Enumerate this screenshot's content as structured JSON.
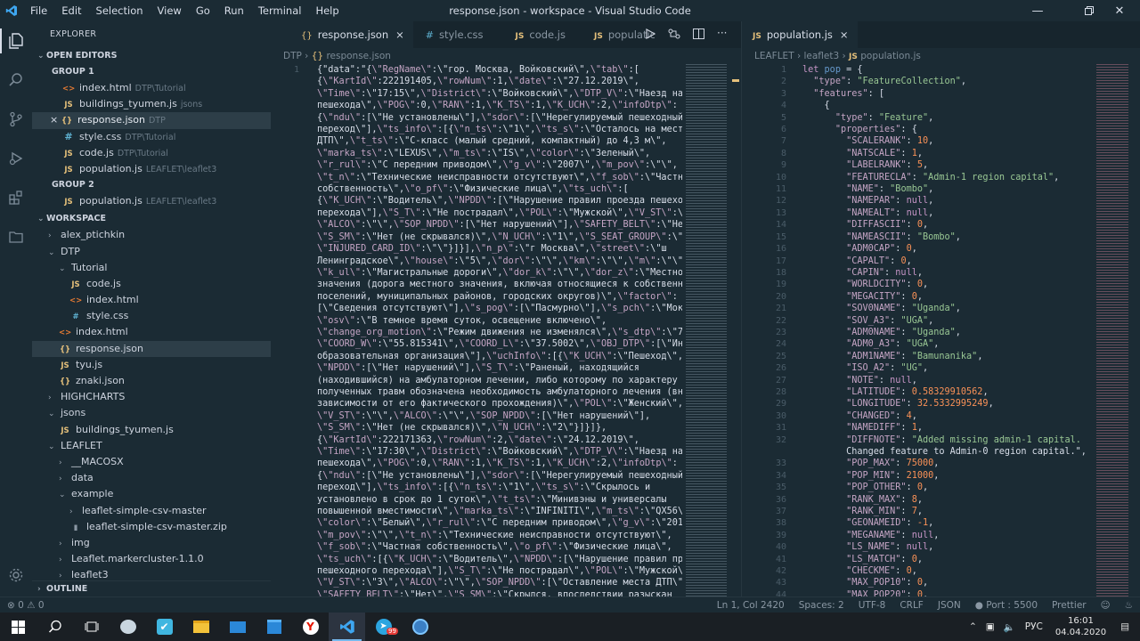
{
  "window": {
    "title": "response.json - workspace - Visual Studio Code",
    "menu": [
      "File",
      "Edit",
      "Selection",
      "View",
      "Go",
      "Run",
      "Terminal",
      "Help"
    ]
  },
  "sidebar": {
    "title": "EXPLORER",
    "open_editors": "OPEN EDITORS",
    "group1": "GROUP 1",
    "group1_items": [
      {
        "name": "index.html",
        "path": "DTP\\Tutorial",
        "icon": "html"
      },
      {
        "name": "buildings_tyumen.js",
        "path": "jsons",
        "icon": "js"
      },
      {
        "name": "response.json",
        "path": "DTP",
        "icon": "json",
        "close": "×"
      },
      {
        "name": "style.css",
        "path": "DTP\\Tutorial",
        "icon": "css"
      },
      {
        "name": "code.js",
        "path": "DTP\\Tutorial",
        "icon": "js"
      },
      {
        "name": "population.js",
        "path": "LEAFLET\\leaflet3",
        "icon": "js"
      }
    ],
    "group2": "GROUP 2",
    "group2_items": [
      {
        "name": "population.js",
        "path": "LEAFLET\\leaflet3",
        "icon": "js"
      }
    ],
    "workspace": "WORKSPACE",
    "tree": [
      {
        "name": "alex_ptichkin",
        "depth": 0,
        "type": "folder"
      },
      {
        "name": "DTP",
        "depth": 0,
        "type": "folder-open"
      },
      {
        "name": "Tutorial",
        "depth": 1,
        "type": "folder-open"
      },
      {
        "name": "code.js",
        "depth": 2,
        "type": "js"
      },
      {
        "name": "index.html",
        "depth": 2,
        "type": "html"
      },
      {
        "name": "style.css",
        "depth": 2,
        "type": "css"
      },
      {
        "name": "index.html",
        "depth": 1,
        "type": "html"
      },
      {
        "name": "response.json",
        "depth": 1,
        "type": "json"
      },
      {
        "name": "tyu.js",
        "depth": 1,
        "type": "js"
      },
      {
        "name": "znaki.json",
        "depth": 1,
        "type": "json"
      },
      {
        "name": "HIGHCHARTS",
        "depth": 0,
        "type": "folder"
      },
      {
        "name": "jsons",
        "depth": 0,
        "type": "folder-open"
      },
      {
        "name": "buildings_tyumen.js",
        "depth": 1,
        "type": "js"
      },
      {
        "name": "LEAFLET",
        "depth": 0,
        "type": "folder-open"
      },
      {
        "name": "__MACOSX",
        "depth": 1,
        "type": "folder"
      },
      {
        "name": "data",
        "depth": 1,
        "type": "folder"
      },
      {
        "name": "example",
        "depth": 1,
        "type": "folder-open"
      },
      {
        "name": "leaflet-simple-csv-master",
        "depth": 2,
        "type": "folder"
      },
      {
        "name": "leaflet-simple-csv-master.zip",
        "depth": 2,
        "type": "zip"
      },
      {
        "name": "img",
        "depth": 1,
        "type": "folder"
      },
      {
        "name": "Leaflet.markercluster-1.1.0",
        "depth": 1,
        "type": "folder"
      },
      {
        "name": "leaflet3",
        "depth": 1,
        "type": "folder"
      }
    ],
    "outline": "OUTLINE"
  },
  "editor1": {
    "tabs": [
      "response.json",
      "style.css",
      "code.js",
      "populatic"
    ],
    "breadcrumb": [
      "DTP",
      "response.json"
    ],
    "lines": [
      "{\"data\":\"{\\\"RegName\\\":\\\"гор. Москва, Войковский\\\",\\\"tab\\\":[",
      "{\\\"KartId\\\":222191405,\\\"rowNum\\\":1,\\\"date\\\":\\\"27.12.2019\\\",",
      "\\\"Time\\\":\\\"17:15\\\",\\\"District\\\":\\\"Войковский\\\",\\\"DTP_V\\\":\\\"Наезд на",
      "пешехода\\\",\\\"POG\\\":0,\\\"RAN\\\":1,\\\"K_TS\\\":1,\\\"K_UCH\\\":2,\\\"infoDtp\\\":",
      "{\\\"ndu\\\":[\\\"Не установлены\\\"],\\\"sdor\\\":[\\\"Нерегулируемый пешеходный",
      "переход\\\"],\\\"ts_info\\\":[{\\\"n_ts\\\":\\\"1\\\",\\\"ts_s\\\":\\\"Осталось на месте",
      "ДТП\\\",\\\"t_ts\\\":\\\"С-класс (малый средний, компактный) до 4,3 м\\\",",
      "\\\"marka_ts\\\":\\\"LEXUS\\\",\\\"m_ts\\\":\\\"IS\\\",\\\"color\\\":\\\"Зеленый\\\",",
      "\\\"r_rul\\\":\\\"С передним приводом\\\",\\\"g_v\\\":\\\"2007\\\",\\\"m_pov\\\":\\\"\\\",",
      "\\\"t_n\\\":\\\"Технические неисправности отсутствуют\\\",\\\"f_sob\\\":\\\"Частная",
      "собственность\\\",\\\"o_pf\\\":\\\"Физические лица\\\",\\\"ts_uch\\\":[",
      "{\\\"K_UCH\\\":\\\"Водитель\\\",\\\"NPDD\\\":[\\\"Нарушение правил проезда пешеходного",
      "перехода\\\"],\\\"S_T\\\":\\\"Не пострадал\\\",\\\"POL\\\":\\\"Мужской\\\",\\\"V_ST\\\":\\\"28\\\",",
      "\\\"ALCO\\\":\\\"\\\",\\\"SOP_NPDD\\\":[\\\"Нет нарушений\\\"],\\\"SAFETY_BELT\\\":\\\"Нет\\\",",
      "\\\"S_SM\\\":\\\"Нет (не скрывался)\\\",\\\"N_UCH\\\":\\\"1\\\",\\\"S_SEAT_GROUP\\\":\\\"\\\",",
      "\\\"INJURED_CARD_ID\\\":\\\"\\\"}]}],\\\"n_p\\\":\\\"г Москва\\\",\\\"street\\\":\\\"ш",
      "Ленинградское\\\",\\\"house\\\":\\\"5\\\",\\\"dor\\\":\\\"\\\",\\\"km\\\":\\\"\\\",\\\"m\\\":\\\"\\\",",
      "\\\"k_ul\\\":\\\"Магистральные дороги\\\",\\\"dor_k\\\":\\\"\\\",\\\"dor_z\\\":\\\"Местного",
      "значения (дорога местного значения, включая относящиеся к собственности",
      "поселений, муниципальных районов, городских округов)\\\",\\\"factor\\\":",
      "[\\\"Сведения отсутствуют\\\"],\\\"s_pog\\\":[\\\"Пасмурно\\\"],\\\"s_pch\\\":\\\"Мокрое\\\",",
      "\\\"osv\\\":\\\"В темное время суток, освещение включено\\\",",
      "\\\"change_org_motion\\\":\\\"Режим движения не изменялся\\\",\\\"s_dtp\\\":\\\"710\\\",",
      "\\\"COORD_W\\\":\\\"55.815341\\\",\\\"COORD_L\\\":\\\"37.5002\\\",\\\"OBJ_DTP\\\":[\\\"Иная",
      "образовательная организация\\\"],\\\"uchInfo\\\":[{\\\"K_UCH\\\":\\\"Пешеход\\\",",
      "\\\"NPDD\\\":[\\\"Нет нарушений\\\"],\\\"S_T\\\":\\\"Раненый, находящийся",
      "(находившийся) на амбулаторном лечении, либо которому по характеру",
      "полученных травм обозначена необходимость амбулаторного лечения (вне",
      "зависимости от его фактического прохождения)\\\",\\\"POL\\\":\\\"Женский\\\",",
      "\\\"V_ST\\\":\\\"\\\",\\\"ALCO\\\":\\\"\\\",\\\"SOP_NPDD\\\":[\\\"Нет нарушений\\\"],",
      "\\\"S_SM\\\":\\\"Нет (не скрывался)\\\",\\\"N_UCH\\\":\\\"2\\\"}]}]},",
      "{\\\"KartId\\\":222171363,\\\"rowNum\\\":2,\\\"date\\\":\\\"24.12.2019\\\",",
      "\\\"Time\\\":\\\"17:30\\\",\\\"District\\\":\\\"Войковский\\\",\\\"DTP_V\\\":\\\"Наезд на",
      "пешехода\\\",\\\"POG\\\":0,\\\"RAN\\\":1,\\\"K_TS\\\":1,\\\"K_UCH\\\":2,\\\"infoDtp\\\":",
      "{\\\"ndu\\\":[\\\"Не установлены\\\"],\\\"sdor\\\":[\\\"Нерегулируемый пешеходный",
      "переход\\\"],\\\"ts_info\\\":[{\\\"n_ts\\\":\\\"1\\\",\\\"ts_s\\\":\\\"Скрылось и",
      "установлено в срок до 1 суток\\\",\\\"t_ts\\\":\\\"Минивэны и универсалы",
      "повышенной вместимости\\\",\\\"marka_ts\\\":\\\"INFINITI\\\",\\\"m_ts\\\":\\\"QX56\\\",",
      "\\\"color\\\":\\\"Белый\\\",\\\"r_rul\\\":\\\"С передним приводом\\\",\\\"g_v\\\":\\\"2012\\\",",
      "\\\"m_pov\\\":\\\"\\\",\\\"t_n\\\":\\\"Технические неисправности отсутствуют\\\",",
      "\\\"f_sob\\\":\\\"Частная собственность\\\",\\\"o_pf\\\":\\\"Физические лица\\\",",
      "\\\"ts_uch\\\":[{\\\"K_UCH\\\":\\\"Водитель\\\",\\\"NPDD\\\":[\\\"Нарушение правил проезда",
      "пешеходного перехода\\\"],\\\"S_T\\\":\\\"Не пострадал\\\",\\\"POL\\\":\\\"Мужской\\\",",
      "\\\"V_ST\\\":\\\"3\\\",\\\"ALCO\\\":\\\"\\\",\\\"SOP_NPDD\\\":[\\\"Оставление места ДТП\\\"],",
      "\\\"SAFETY_BELT\\\":\\\"Нет\\\",\\\"S_SM\\\":\\\"Скрылся, впоследствии разыскан"
    ],
    "line_number": "1"
  },
  "editor2": {
    "tab": "population.js",
    "breadcrumb": [
      "LEAFLET",
      "leaflet3",
      "population.js"
    ],
    "line_numbers": [
      "1",
      "2",
      "3",
      "4",
      "5",
      "6",
      "7",
      "8",
      "9",
      "10",
      "11",
      "12",
      "13",
      "14",
      "15",
      "16",
      "17",
      "18",
      "19",
      "20",
      "21",
      "22",
      "23",
      "24",
      "25",
      "26",
      "27",
      "28",
      "29",
      "30",
      "31",
      "32",
      "",
      "33",
      "34",
      "35",
      "36",
      "37",
      "38",
      "39",
      "40",
      "41",
      "42",
      "43",
      "44",
      "45",
      "46"
    ],
    "lines": [
      "let pop = {",
      "  \"type\": \"FeatureCollection\",",
      "  \"features\": [",
      "    {",
      "      \"type\": \"Feature\",",
      "      \"properties\": {",
      "        \"SCALERANK\": 10,",
      "        \"NATSCALE\": 1,",
      "        \"LABELRANK\": 5,",
      "        \"FEATURECLA\": \"Admin-1 region capital\",",
      "        \"NAME\": \"Bombo\",",
      "        \"NAMEPAR\": null,",
      "        \"NAMEALT\": null,",
      "        \"DIFFASCII\": 0,",
      "        \"NAMEASCII\": \"Bombo\",",
      "        \"ADM0CAP\": 0,",
      "        \"CAPALT\": 0,",
      "        \"CAPIN\": null,",
      "        \"WORLDCITY\": 0,",
      "        \"MEGACITY\": 0,",
      "        \"SOV0NAME\": \"Uganda\",",
      "        \"SOV_A3\": \"UGA\",",
      "        \"ADM0NAME\": \"Uganda\",",
      "        \"ADM0_A3\": \"UGA\",",
      "        \"ADM1NAME\": \"Bamunanika\",",
      "        \"ISO_A2\": \"UG\",",
      "        \"NOTE\": null,",
      "        \"LATITUDE\": 0.58329910562,",
      "        \"LONGITUDE\": 32.5332995249,",
      "        \"CHANGED\": 4,",
      "        \"NAMEDIFF\": 1,",
      "        \"DIFFNOTE\": \"Added missing admin-1 capital.",
      "        Changed feature to Admin-0 region capital.\",",
      "        \"POP_MAX\": 75000,",
      "        \"POP_MIN\": 21000,",
      "        \"POP_OTHER\": 0,",
      "        \"RANK_MAX\": 8,",
      "        \"RANK_MIN\": 7,",
      "        \"GEONAMEID\": -1,",
      "        \"MEGANAME\": null,",
      "        \"LS_NAME\": null,",
      "        \"LS_MATCH\": 0,",
      "        \"CHECKME\": 0,",
      "        \"MAX_POP10\": 0,",
      "        \"MAX_POP20\": 0,"
    ]
  },
  "status": {
    "errors": "0",
    "warnings": "0",
    "position": "Ln 1, Col 2420",
    "spaces": "Spaces: 2",
    "encoding": "UTF-8",
    "eol": "CRLF",
    "language": "JSON",
    "port": "Port : 5500",
    "formatter": "Prettier"
  },
  "taskbar": {
    "lang": "РУС",
    "time": "16:01",
    "date": "04.04.2020",
    "badge": "99"
  },
  "colors": {
    "bg": "#1b2b34",
    "accent": "#e5c07b",
    "string": "#99c794",
    "number": "#f99157",
    "key": "#c5a5c5"
  }
}
